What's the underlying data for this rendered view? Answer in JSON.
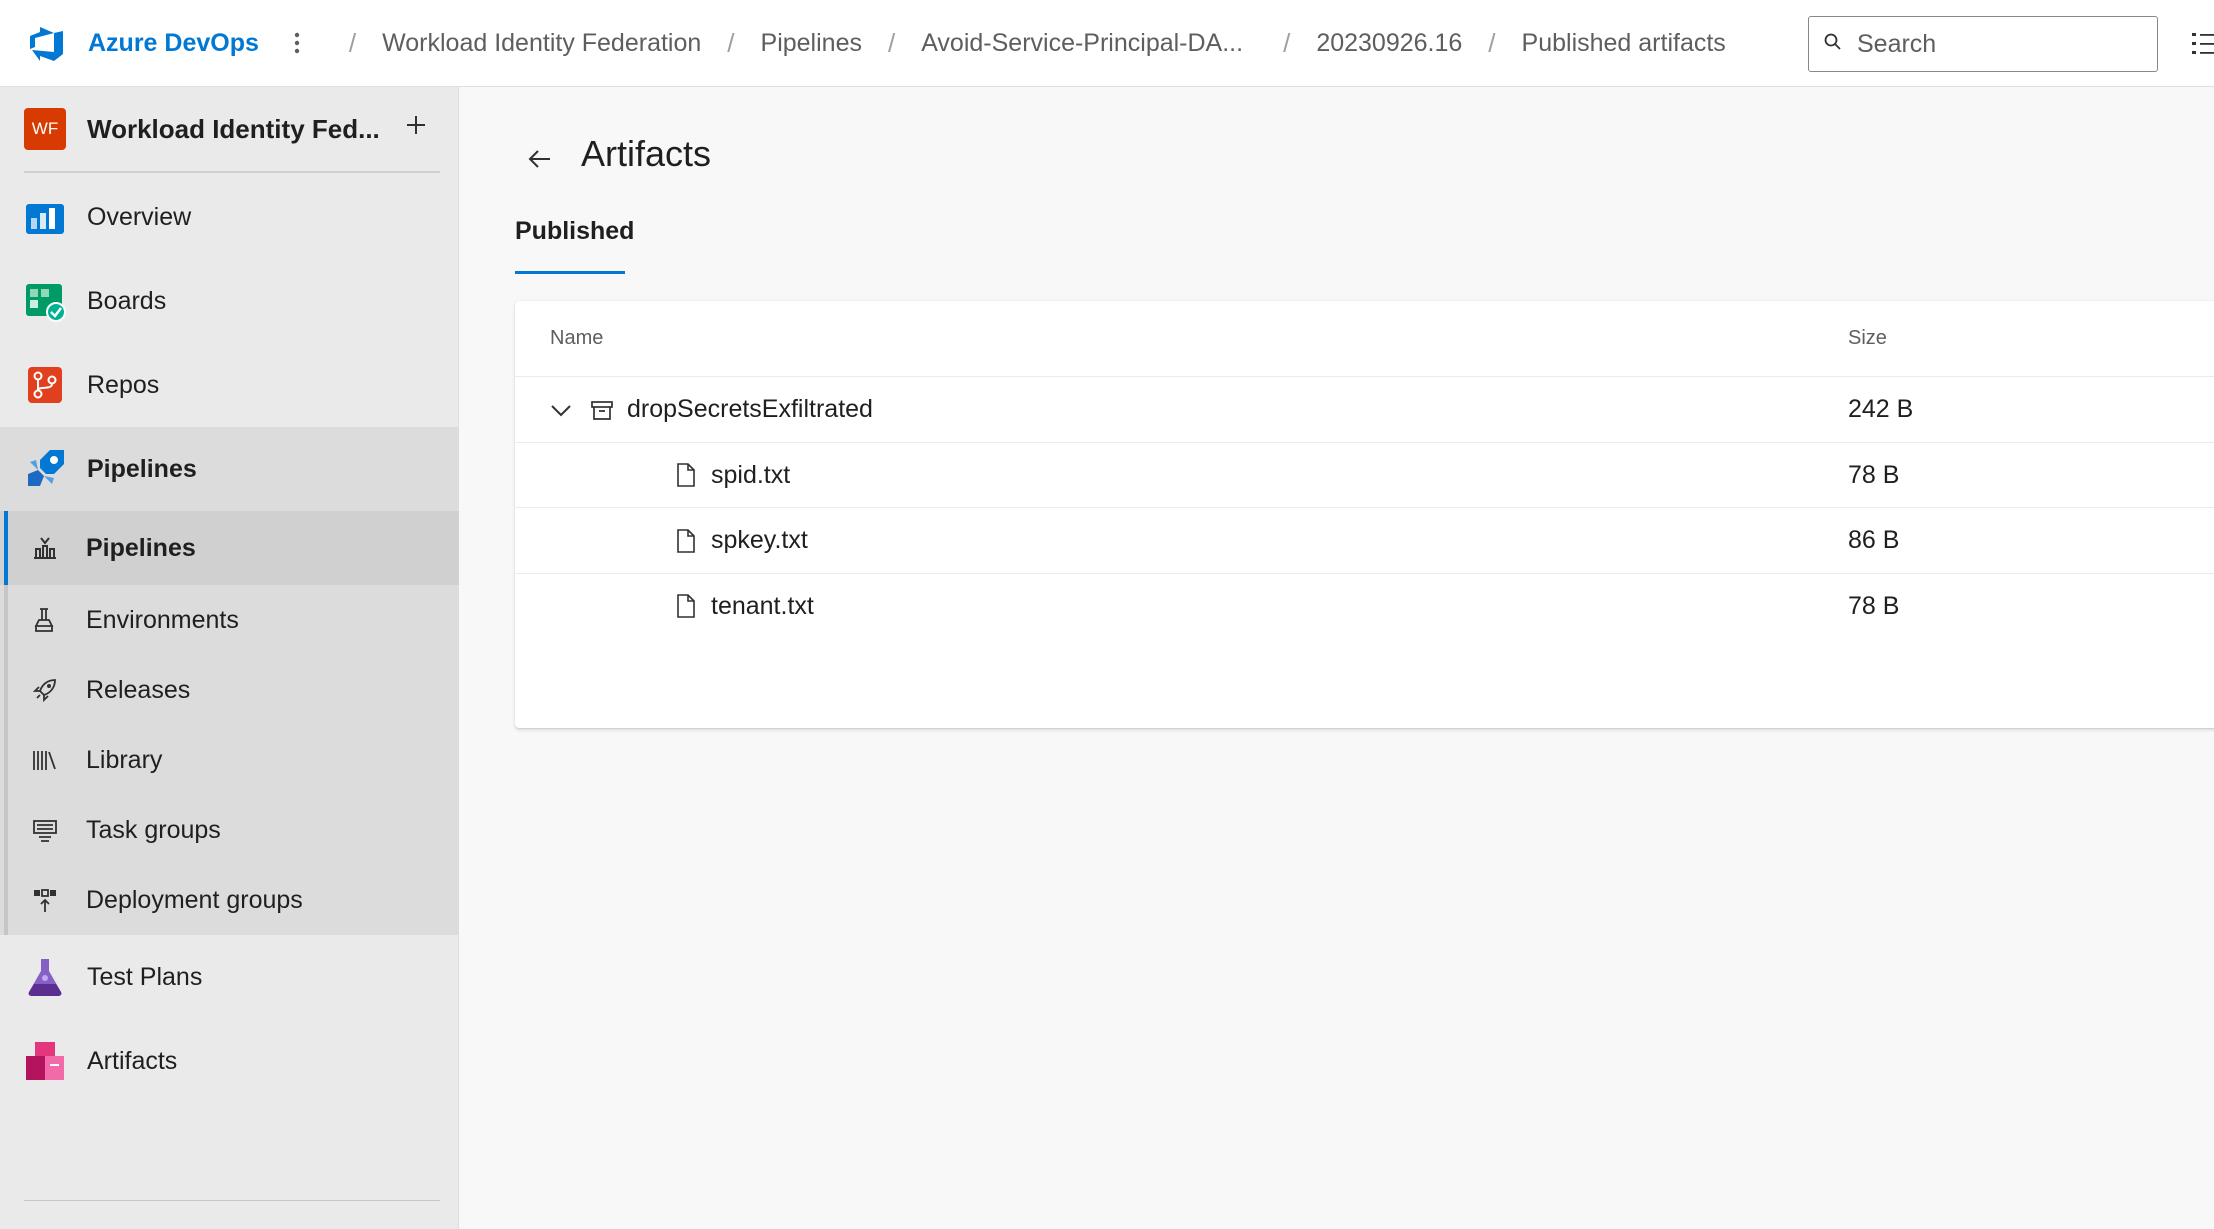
{
  "header": {
    "brand": "Azure DevOps",
    "breadcrumbs": [
      "Workload Identity Federation",
      "Pipelines",
      "Avoid-Service-Principal-DA...",
      "20230926.16",
      "Published artifacts"
    ],
    "separator": "/",
    "search_placeholder": "Search"
  },
  "sidebar": {
    "project_initials": "WF",
    "project_name": "Workload Identity Fed...",
    "items": [
      {
        "label": "Overview",
        "icon": "overview-icon"
      },
      {
        "label": "Boards",
        "icon": "boards-icon"
      },
      {
        "label": "Repos",
        "icon": "repos-icon"
      },
      {
        "label": "Pipelines",
        "icon": "pipelines-icon"
      }
    ],
    "pipelines_sub": [
      {
        "label": "Pipelines",
        "icon": "pipelines-sub-icon"
      },
      {
        "label": "Environments",
        "icon": "environments-icon"
      },
      {
        "label": "Releases",
        "icon": "releases-icon"
      },
      {
        "label": "Library",
        "icon": "library-icon"
      },
      {
        "label": "Task groups",
        "icon": "task-groups-icon"
      },
      {
        "label": "Deployment groups",
        "icon": "deployment-groups-icon"
      }
    ],
    "after": [
      {
        "label": "Test Plans",
        "icon": "test-plans-icon"
      },
      {
        "label": "Artifacts",
        "icon": "artifacts-icon"
      }
    ]
  },
  "main": {
    "title": "Artifacts",
    "tab": "Published",
    "table": {
      "columns": [
        "Name",
        "Size"
      ],
      "rows": [
        {
          "name": "dropSecretsExfiltrated",
          "size": "242 B",
          "type": "folder"
        },
        {
          "name": "spid.txt",
          "size": "78 B",
          "type": "file"
        },
        {
          "name": "spkey.txt",
          "size": "86 B",
          "type": "file"
        },
        {
          "name": "tenant.txt",
          "size": "78 B",
          "type": "file"
        }
      ]
    }
  },
  "colors": {
    "accent": "#0078d4",
    "project_avatar": "#d83b01"
  }
}
